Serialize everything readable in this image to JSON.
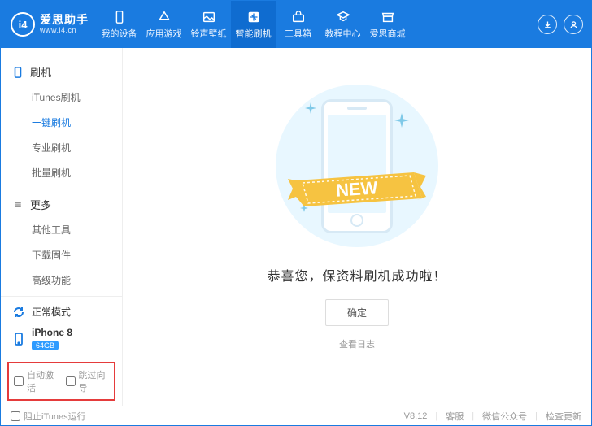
{
  "app": {
    "name": "爱思助手",
    "url": "www.i4.cn",
    "logo_text": "i4"
  },
  "header_tabs": [
    {
      "label": "我的设备"
    },
    {
      "label": "应用游戏"
    },
    {
      "label": "铃声壁纸"
    },
    {
      "label": "智能刷机"
    },
    {
      "label": "工具箱"
    },
    {
      "label": "教程中心"
    },
    {
      "label": "爱思商城"
    }
  ],
  "sidebar": {
    "flash_header": "刷机",
    "flash_items": [
      {
        "label": "iTunes刷机"
      },
      {
        "label": "一键刷机"
      },
      {
        "label": "专业刷机"
      },
      {
        "label": "批量刷机"
      }
    ],
    "more_header": "更多",
    "more_items": [
      {
        "label": "其他工具"
      },
      {
        "label": "下载固件"
      },
      {
        "label": "高级功能"
      }
    ],
    "mode": "正常模式",
    "device_name": "iPhone 8",
    "device_storage": "64GB",
    "auto_activate": "自动激活",
    "skip_guide": "跳过向导"
  },
  "main": {
    "ribbon_text": "NEW",
    "success_text": "恭喜您，保资料刷机成功啦！",
    "ok_button": "确定",
    "log_link": "查看日志"
  },
  "footer": {
    "block_itunes": "阻止iTunes运行",
    "version": "V8.12",
    "service": "客服",
    "wechat": "微信公众号",
    "update": "检查更新"
  }
}
